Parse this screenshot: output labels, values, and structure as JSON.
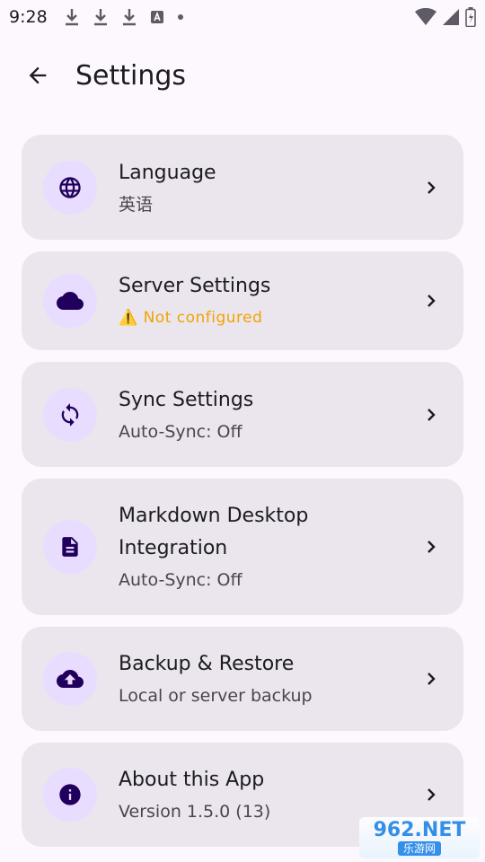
{
  "status_bar": {
    "time": "9:28",
    "left_icons": [
      "download-icon",
      "download-icon",
      "download-icon",
      "a-box-icon",
      "dot-icon"
    ],
    "right_icons": [
      "wifi-icon",
      "signal-icon",
      "battery-icon"
    ]
  },
  "app_bar": {
    "title": "Settings",
    "back_icon": "arrow-back-icon"
  },
  "items": [
    {
      "title": "Language",
      "subtitle": "英语",
      "icon": "globe-icon"
    },
    {
      "title": "Server Settings",
      "subtitle": "⚠️ Not configured",
      "icon": "cloud-icon",
      "subtitle_color": "#f0a400"
    },
    {
      "title": "Sync Settings",
      "subtitle": "Auto-Sync: Off",
      "icon": "sync-icon"
    },
    {
      "title": "Markdown Desktop Integration",
      "subtitle": "Auto-Sync: Off",
      "icon": "document-icon"
    },
    {
      "title": "Backup & Restore",
      "subtitle": "Local or server backup",
      "icon": "cloud-upload-icon"
    },
    {
      "title": "About this App",
      "subtitle": "Version 1.5.0 (13)",
      "icon": "info-icon"
    }
  ],
  "watermark": {
    "top": "962.NET",
    "bottom": "乐游网"
  },
  "colors": {
    "background": "#fdf7fe",
    "card": "#ebe5ee",
    "icon_circle": "#e9ddff",
    "icon": "#21005d",
    "warning": "#f0a400"
  }
}
